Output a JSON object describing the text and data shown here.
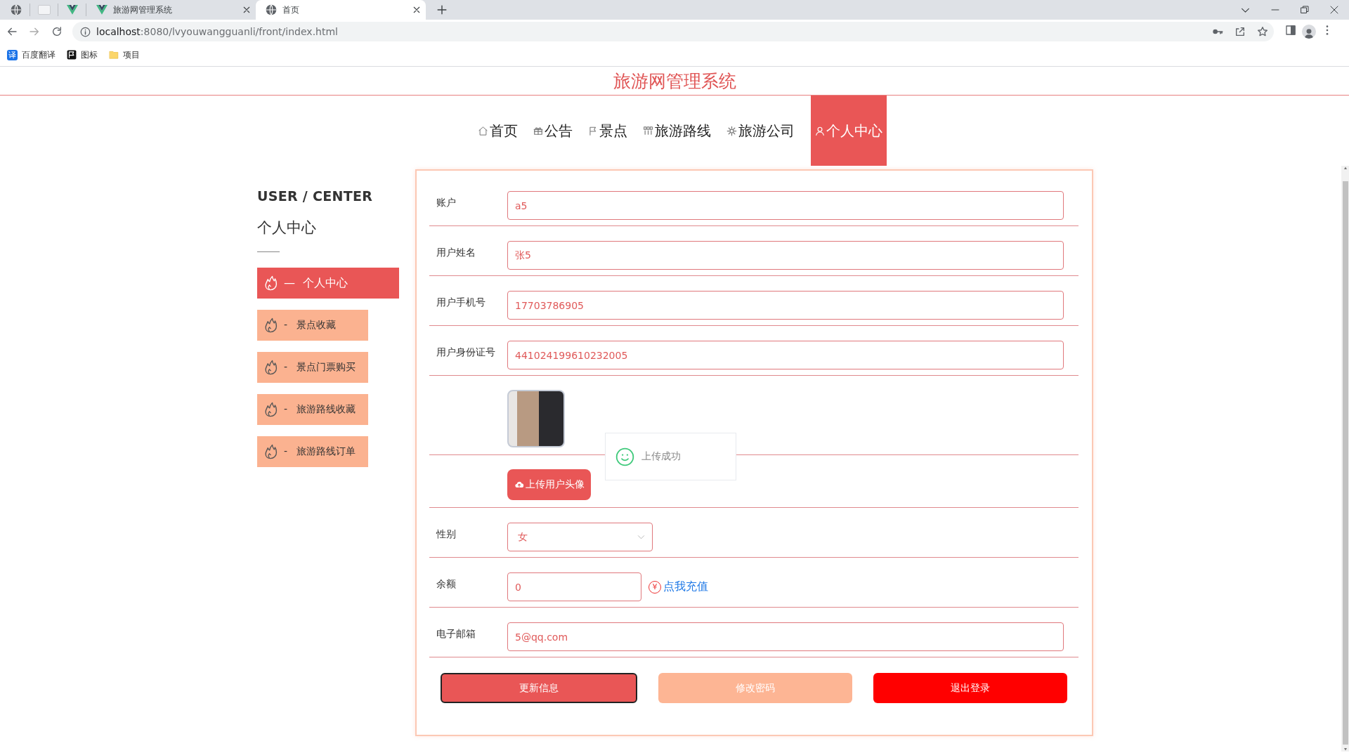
{
  "browser": {
    "tabs": [
      {
        "title": "旅游网管理系统",
        "selected": false
      },
      {
        "title": "首页",
        "selected": true
      }
    ],
    "address": {
      "host": "localhost",
      "path": ":8080/lvyouwangguanli/front/index.html"
    },
    "bookmarks": [
      {
        "label": "百度翻译",
        "glyph": "译"
      },
      {
        "label": "图标"
      },
      {
        "label": "项目"
      }
    ]
  },
  "site_title": "旅游网管理系统",
  "nav": [
    {
      "label": "首页",
      "selected": false
    },
    {
      "label": "公告",
      "selected": false
    },
    {
      "label": "景点",
      "selected": false
    },
    {
      "label": "旅游路线",
      "selected": false
    },
    {
      "label": "旅游公司",
      "selected": false
    },
    {
      "label": "个人中心",
      "selected": true
    }
  ],
  "sidebar": {
    "heading_en": "USER / CENTER",
    "heading": "个人中心",
    "items": [
      {
        "label": "— 个人中心",
        "selected": true
      },
      {
        "label": "- 景点收藏",
        "selected": false
      },
      {
        "label": "- 景点门票购买",
        "selected": false
      },
      {
        "label": "- 旅游路线收藏",
        "selected": false
      },
      {
        "label": "- 旅游路线订单",
        "selected": false
      }
    ]
  },
  "form": {
    "fields": [
      {
        "kind": "text",
        "label": "账户",
        "value": "a5"
      },
      {
        "kind": "text",
        "label": "用户姓名",
        "value": "张5"
      },
      {
        "kind": "text",
        "label": "用户手机号",
        "value": "17703786905"
      },
      {
        "kind": "text",
        "label": "用户身份证号",
        "value": "441024199610232005"
      },
      {
        "kind": "avatar"
      },
      {
        "kind": "upload",
        "button": "上传用户头像"
      },
      {
        "kind": "select",
        "label": "性别",
        "value": "女"
      },
      {
        "kind": "balance",
        "label": "余额",
        "value": "0",
        "symbol": "¥",
        "link": "点我充值"
      },
      {
        "kind": "text",
        "label": "电子邮箱",
        "value": "5@qq.com"
      }
    ],
    "buttons": [
      {
        "label": "更新信息",
        "kind": "primary",
        "focused": true
      },
      {
        "label": "修改密码",
        "kind": "secondary",
        "focused": false
      },
      {
        "label": "退出登录",
        "kind": "danger",
        "focused": false
      }
    ]
  },
  "toast": {
    "message": "上传成功"
  }
}
